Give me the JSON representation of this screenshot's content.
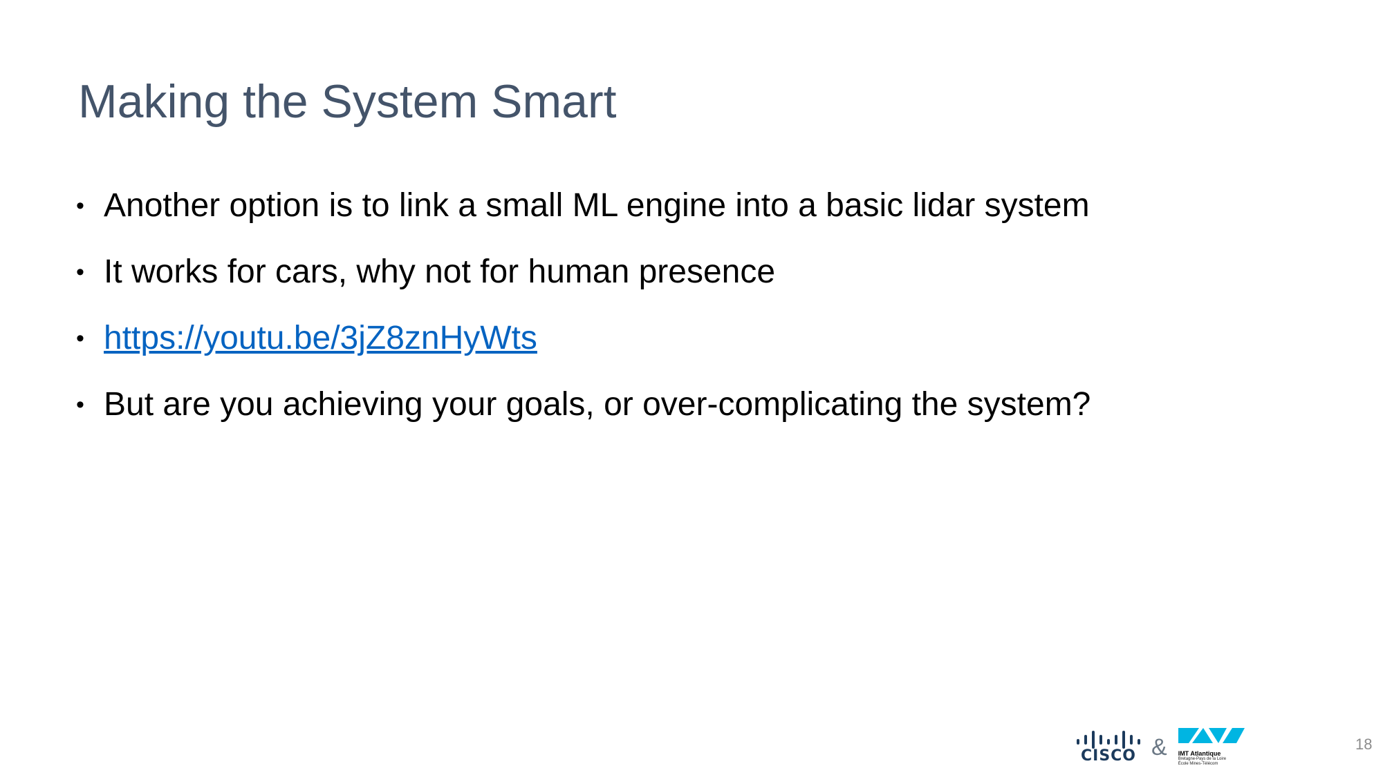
{
  "slide": {
    "title": "Making the System Smart",
    "bullets": [
      {
        "text": "Another option is to link a small ML engine into a basic lidar system",
        "is_link": false
      },
      {
        "text": "It works for cars, why not for human presence",
        "is_link": false
      },
      {
        "text": "https://youtu.be/3jZ8znHyWts",
        "is_link": true
      },
      {
        "text": "But are you achieving your goals, or over-complicating the system?",
        "is_link": false
      }
    ],
    "bullet_symbol": "•",
    "page_number": "18"
  },
  "footer": {
    "cisco_logo_text": "CISCO",
    "ampersand": "&",
    "imt_logo": {
      "name": "IMT Atlantique",
      "line1": "Bretagne-Pays de la Loire",
      "line2": "École Mines-Télécom"
    }
  },
  "colors": {
    "title": "#44546a",
    "body_text": "#000000",
    "link": "#0563c1",
    "cisco_blue": "#1b3a5c",
    "imt_cyan": "#00b5e2",
    "page_number": "#8c8c8c"
  },
  "icons": {
    "cisco_bars": "cisco-bars-icon",
    "imt_shape": "imt-logo-icon"
  }
}
